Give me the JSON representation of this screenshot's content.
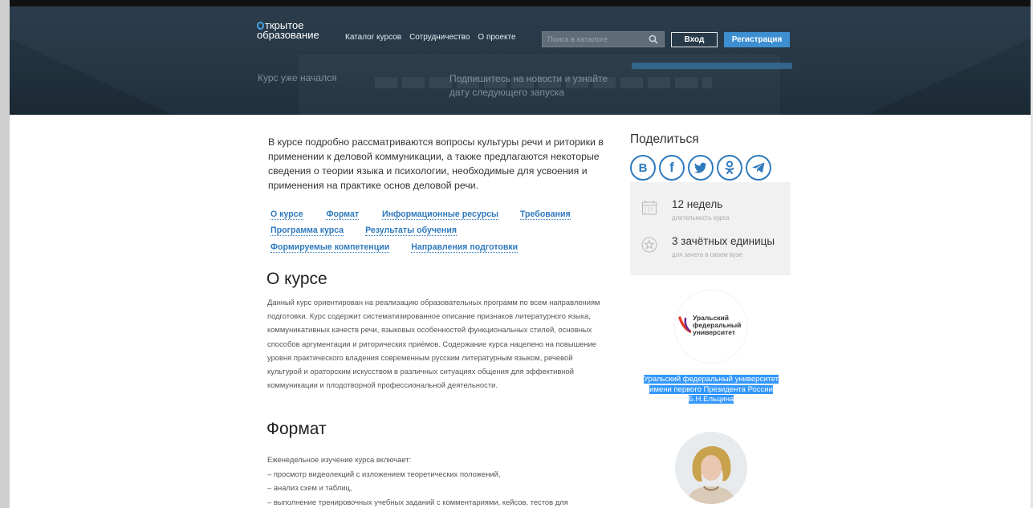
{
  "header": {
    "logo_line1": "ткрытое",
    "logo_line2": "образование",
    "nav": [
      "Каталог курсов",
      "Сотрудничество",
      "О проекте"
    ],
    "search_placeholder": "Поиск в каталоге",
    "login_label": "Вход",
    "register_label": "Регистрация"
  },
  "hero": {
    "status": "Курс уже начался",
    "subscribe": "Подпишитесь на новости и узнайте дату следующего запуска"
  },
  "main": {
    "intro": "В курсе подробно рассматриваются вопросы культуры речи и риторики в применении к деловой коммуникации, а также предлагаются некоторые сведения о теории языка и психологии, необходимые для усвоения и применения на практике основ деловой речи.",
    "anchors": {
      "row1": [
        "О курсе",
        "Формат",
        "Информационные ресурсы",
        "Требования"
      ],
      "row2": [
        "Программа курса",
        "Результаты обучения"
      ],
      "row3": [
        "Формируемые компетенции",
        "Направления подготовки"
      ]
    },
    "about_title": "О курсе",
    "about_text": "Данный курс ориентирован на реализацию образовательных программ по всем направлениям подготовки. Курс содержит систематизированное описание признаков литературного языка, коммуникативных качеств речи, языковых особенностей функциональных стилей, основных способов аргументации и риторических приёмов. Содержание курса нацелено на повышение уровня практического владения современным русским литературным языком, речевой культурой и ораторским искусством в различных ситуациях общения для эффективной коммуникации и плодотворной профессиональной деятельности.",
    "format_title": "Формат",
    "format_lines": [
      "Еженедельное изучение курса включает:",
      "– просмотр видеолекций с изложением теоретических положений,",
      "– анализ схем и таблиц,",
      "– выполнение тренировочных учебных заданий с комментариями, кейсов, тестов для"
    ]
  },
  "sidebar": {
    "share_title": "Поделиться",
    "share_icons": [
      "В",
      "f",
      "twitter",
      "ok",
      "telegram"
    ],
    "duration_value": "12 недель",
    "duration_label": "длительность курса",
    "credits_value": "3 зачётных единицы",
    "credits_label": "для зачета в своем вузе",
    "university_logo_text": "Уральский федеральный университет",
    "university_link": "Уральский федеральный университет имени первого Президента России Б.Н.Ельцина"
  },
  "colors": {
    "header_bg": "#263846",
    "accent_blue": "#3d8fd1",
    "link_blue": "#2f7abd",
    "selection": "#3297fd",
    "stats_bg": "#f1f1f1"
  }
}
